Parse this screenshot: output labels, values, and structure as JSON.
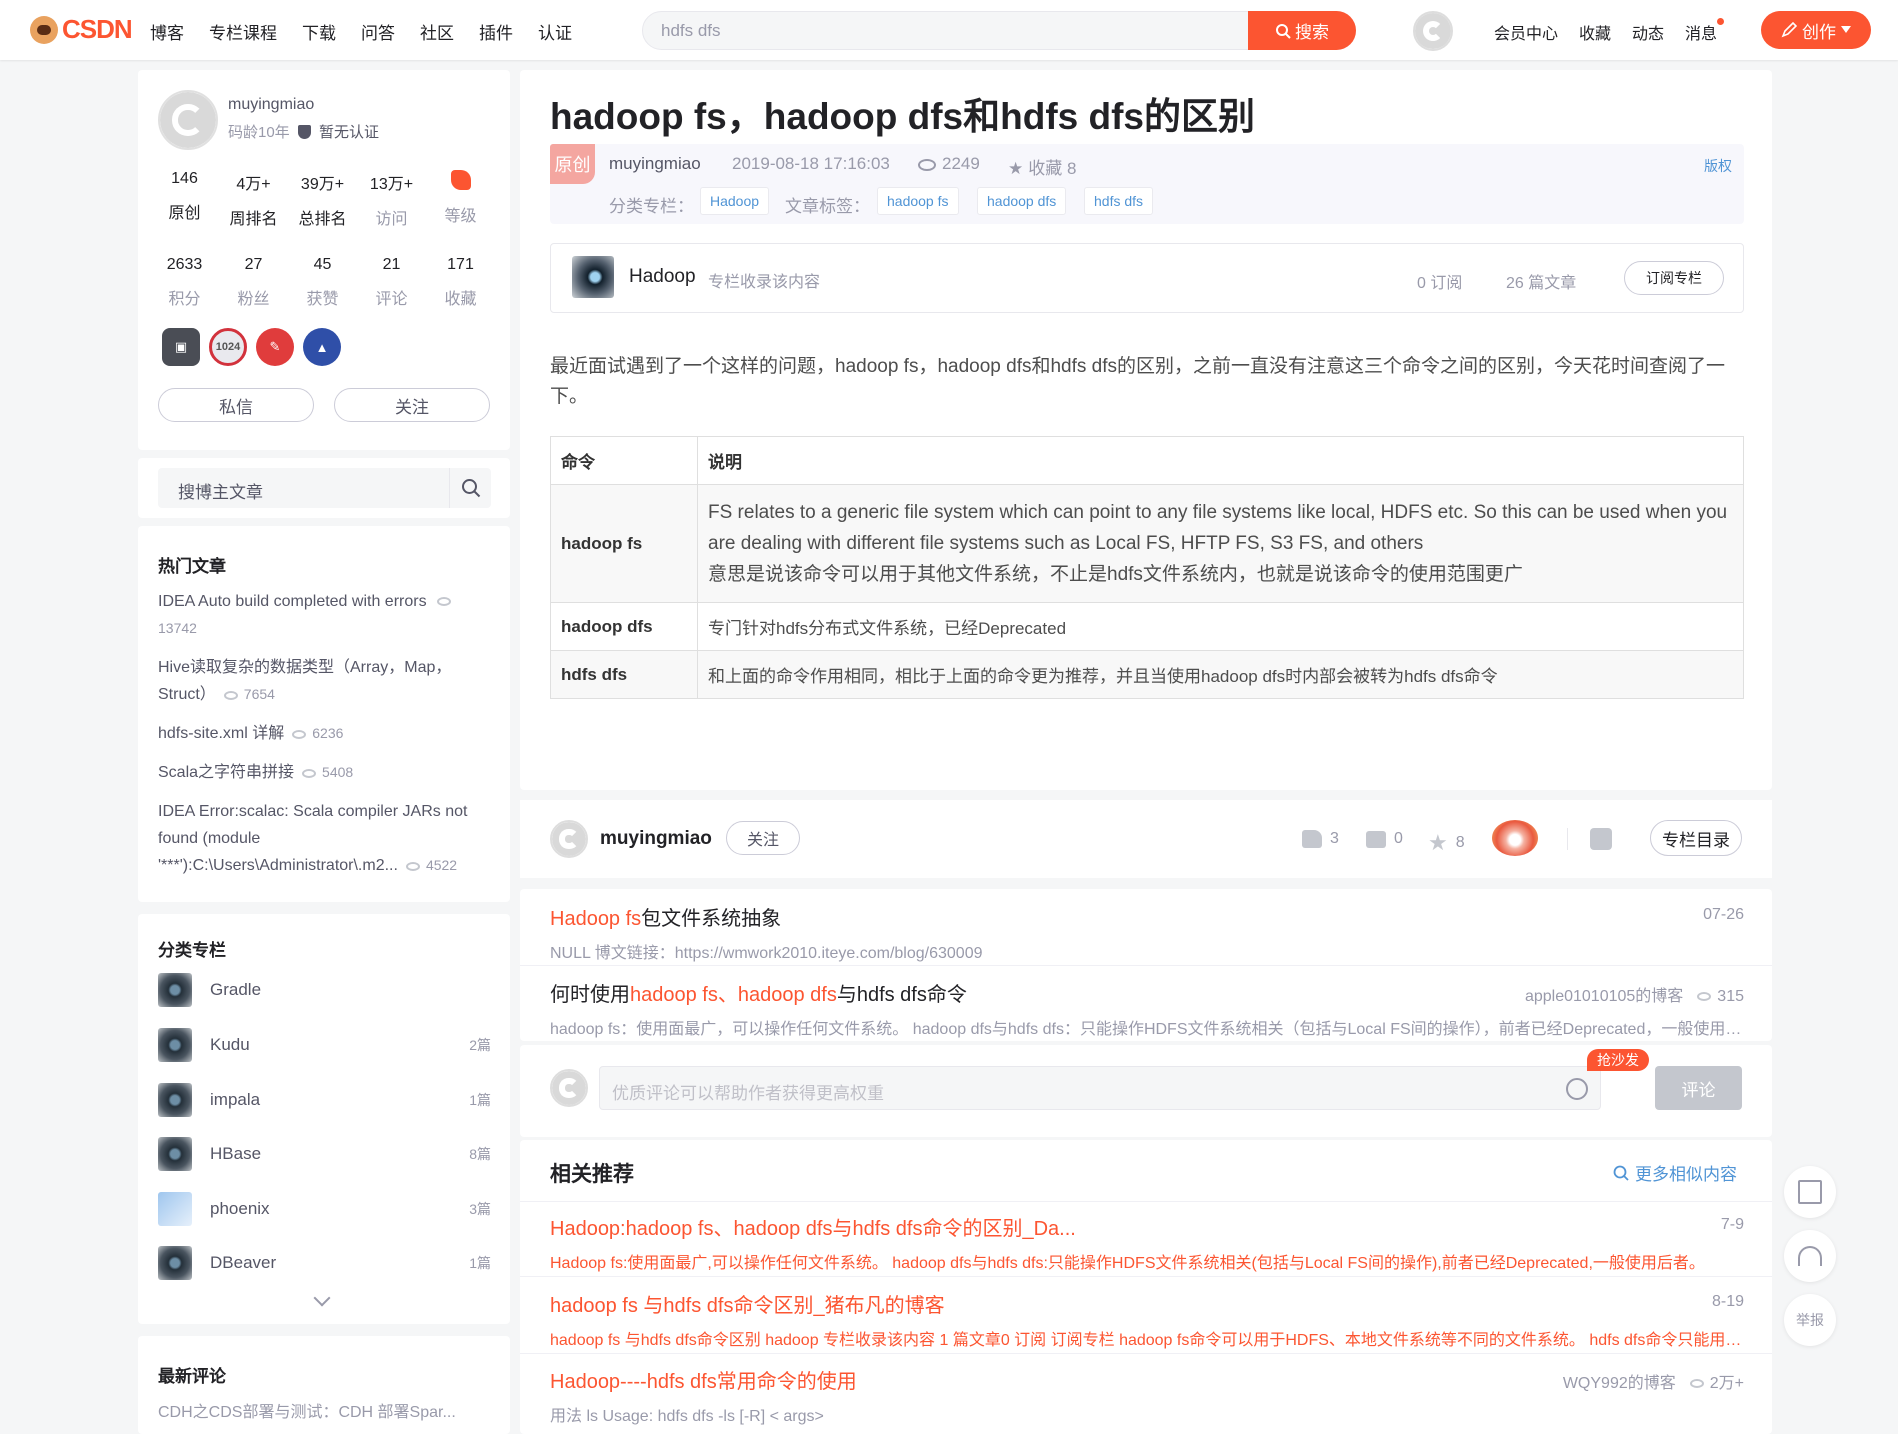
{
  "topbar": {
    "logo": "CSDN",
    "nav": [
      "博客",
      "专栏课程",
      "下载",
      "问答",
      "社区",
      "插件",
      "认证"
    ],
    "search_value": "hdfs dfs",
    "search_button": "搜索",
    "links": [
      "会员中心",
      "收藏",
      "动态",
      "消息"
    ],
    "create": "创作"
  },
  "profile": {
    "name": "muyingmiao",
    "code_age": "码龄10年",
    "cert": "暂无认证",
    "stats1": [
      {
        "n": "146",
        "l": "原创"
      },
      {
        "n": "4万+",
        "l": "周排名"
      },
      {
        "n": "39万+",
        "l": "总排名"
      },
      {
        "n": "13万+",
        "l": "访问"
      },
      {
        "n": "",
        "l": "等级"
      }
    ],
    "stats2": [
      {
        "n": "2633",
        "l": "积分"
      },
      {
        "n": "27",
        "l": "粉丝"
      },
      {
        "n": "45",
        "l": "获赞"
      },
      {
        "n": "21",
        "l": "评论"
      },
      {
        "n": "171",
        "l": "收藏"
      }
    ],
    "badge_1024": "1024",
    "message_btn": "私信",
    "follow_btn": "关注"
  },
  "side_search": "搜博主文章",
  "hot": {
    "title": "热门文章",
    "items": [
      {
        "t": "IDEA Auto build completed with errors",
        "c": "13742"
      },
      {
        "t": "Hive读取复杂的数据类型（Array，Map，Struct）",
        "c": "7654"
      },
      {
        "t": "hdfs-site.xml 详解",
        "c": "6236"
      },
      {
        "t": "Scala之字符串拼接",
        "c": "5408"
      },
      {
        "t": "IDEA Error:scalac: Scala compiler JARs not found (module '***'):C:\\Users\\Administrator\\.m2...",
        "c": "4522"
      }
    ]
  },
  "columns": {
    "title": "分类专栏",
    "items": [
      {
        "name": "Gradle",
        "cnt": ""
      },
      {
        "name": "Kudu",
        "cnt": "2篇"
      },
      {
        "name": "impala",
        "cnt": "1篇"
      },
      {
        "name": "HBase",
        "cnt": "8篇"
      },
      {
        "name": "phoenix",
        "cnt": "3篇"
      },
      {
        "name": "DBeaver",
        "cnt": "1篇"
      }
    ]
  },
  "latest_comments": {
    "title": "最新评论",
    "first": "CDH之CDS部署与测试：CDH 部署Spar..."
  },
  "article": {
    "title": "hadoop fs，hadoop dfs和hdfs dfs的区别",
    "badge": "原创",
    "author": "muyingmiao",
    "date": "2019-08-18 17:16:03",
    "views": "2249",
    "favorites": "收藏 8",
    "copyright": "版权",
    "column_label": "分类专栏：",
    "column_tag": "Hadoop",
    "tags_label": "文章标签：",
    "tags": [
      "hadoop fs",
      "hadoop dfs",
      "hdfs dfs"
    ],
    "column_box": {
      "name": "Hadoop",
      "note": "专栏收录该内容",
      "subs": "0 订阅",
      "count": "26 篇文章",
      "btn": "订阅专栏"
    },
    "intro": "最近面试遇到了一个这样的问题，hadoop fs，hadoop dfs和hdfs dfs的区别，之前一直没有注意这三个命令之间的区别，今天花时间查阅了一下。",
    "table": {
      "headers": [
        "命令",
        "说明"
      ],
      "rows": [
        {
          "cmd": "hadoop fs",
          "desc1": "FS relates to a generic file system which can point to any file systems like local, HDFS etc. So this can be used when you are dealing with different file systems such as Local FS, HFTP FS, S3 FS, and others",
          "desc2": "意思是说该命令可以用于其他文件系统，不止是hdfs文件系统内，也就是说该命令的使用范围更广"
        },
        {
          "cmd": "hadoop dfs",
          "desc1": "专门针对hdfs分布式文件系统，已经Deprecated",
          "desc2": ""
        },
        {
          "cmd": "hdfs dfs",
          "desc1": "和上面的命令作用相同，相比于上面的命令更为推荐，并且当使用hadoop dfs时内部会被转为hdfs dfs命令",
          "desc2": ""
        }
      ]
    }
  },
  "authbar": {
    "name": "muyingmiao",
    "follow": "关注",
    "likes": "3",
    "comments": "0",
    "stars": "8",
    "toc": "专栏目录"
  },
  "related_top": [
    {
      "pre": "",
      "hl": "Hadoop fs",
      "rest": "包文件系统抽象",
      "right": "07-26",
      "desc": "NULL 博文链接：https://wmwork2010.iteye.com/blog/630009"
    },
    {
      "pre": "何时使用",
      "hl": "hadoop fs、hadoop dfs",
      "rest": "与hdfs dfs命令",
      "right": "apple01010105的博客",
      "views": "315",
      "desc": "hadoop fs：使用面最广，可以操作任何文件系统。 hadoop dfs与hdfs dfs：只能操作HDFS文件系统相关（包括与Local FS间的操作），前者已经Deprecated，一般使用后者。"
    }
  ],
  "comment": {
    "placeholder": "优质评论可以帮助作者获得更高权重",
    "sofa": "抢沙发",
    "btn": "评论"
  },
  "recommend": {
    "title": "相关推荐",
    "more": "更多相似内容",
    "items": [
      {
        "t": "Hadoop:hadoop fs、hadoop dfs与hdfs dfs命令的区别_Da...",
        "right": "7-9",
        "desc": "Hadoop fs:使用面最广,可以操作任何文件系统。 hadoop dfs与hdfs dfs:只能操作HDFS文件系统相关(包括与Local FS间的操作),前者已经Deprecated,一般使用后者。"
      },
      {
        "t": "hadoop fs 与hdfs dfs命令区别_猪布凡的博客",
        "right": "8-19",
        "desc": "hadoop fs 与hdfs dfs命令区别 hadoop 专栏收录该内容 1 篇文章0 订阅 订阅专栏 hadoop fs命令可以用于HDFS、本地文件系统等不同的文件系统。 hdfs dfs命令只能用于HDFS"
      },
      {
        "t": "Hadoop----hdfs dfs常用命令的使用",
        "right": "WQY992的博客",
        "views": "2万+",
        "desc": "用法 ls Usage: hdfs dfs -ls [-R] < args>"
      }
    ]
  },
  "float": {
    "report": "举报"
  },
  "colors": {
    "accent": "#fc5531",
    "link": "#5094d5"
  }
}
